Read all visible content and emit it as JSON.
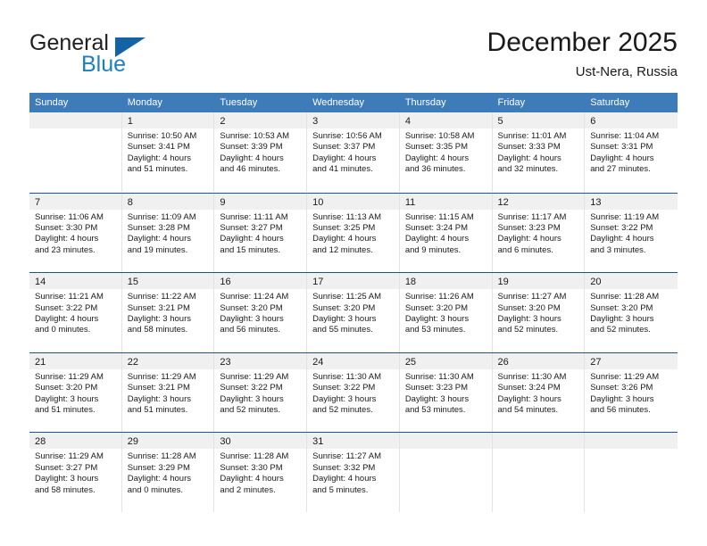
{
  "brand": {
    "name_top": "General",
    "name_bottom": "Blue",
    "triangle_color": "#1464a5",
    "blue_color": "#1b7fc4"
  },
  "header": {
    "title": "December 2025",
    "subtitle": "Ust-Nera, Russia"
  },
  "theme": {
    "header_row_bg": "#3d7cb8",
    "header_row_text": "#ffffff",
    "week_divider": "#1a5694",
    "daynum_band_bg": "#f0f0f0",
    "cell_divider": "#e3e3e3",
    "text": "#1a1a1a"
  },
  "weekdays": [
    "Sunday",
    "Monday",
    "Tuesday",
    "Wednesday",
    "Thursday",
    "Friday",
    "Saturday"
  ],
  "weeks": [
    [
      {
        "day": "",
        "sunrise": "",
        "sunset": "",
        "daylight1": "",
        "daylight2": ""
      },
      {
        "day": "1",
        "sunrise": "Sunrise: 10:50 AM",
        "sunset": "Sunset: 3:41 PM",
        "daylight1": "Daylight: 4 hours",
        "daylight2": "and 51 minutes."
      },
      {
        "day": "2",
        "sunrise": "Sunrise: 10:53 AM",
        "sunset": "Sunset: 3:39 PM",
        "daylight1": "Daylight: 4 hours",
        "daylight2": "and 46 minutes."
      },
      {
        "day": "3",
        "sunrise": "Sunrise: 10:56 AM",
        "sunset": "Sunset: 3:37 PM",
        "daylight1": "Daylight: 4 hours",
        "daylight2": "and 41 minutes."
      },
      {
        "day": "4",
        "sunrise": "Sunrise: 10:58 AM",
        "sunset": "Sunset: 3:35 PM",
        "daylight1": "Daylight: 4 hours",
        "daylight2": "and 36 minutes."
      },
      {
        "day": "5",
        "sunrise": "Sunrise: 11:01 AM",
        "sunset": "Sunset: 3:33 PM",
        "daylight1": "Daylight: 4 hours",
        "daylight2": "and 32 minutes."
      },
      {
        "day": "6",
        "sunrise": "Sunrise: 11:04 AM",
        "sunset": "Sunset: 3:31 PM",
        "daylight1": "Daylight: 4 hours",
        "daylight2": "and 27 minutes."
      }
    ],
    [
      {
        "day": "7",
        "sunrise": "Sunrise: 11:06 AM",
        "sunset": "Sunset: 3:30 PM",
        "daylight1": "Daylight: 4 hours",
        "daylight2": "and 23 minutes."
      },
      {
        "day": "8",
        "sunrise": "Sunrise: 11:09 AM",
        "sunset": "Sunset: 3:28 PM",
        "daylight1": "Daylight: 4 hours",
        "daylight2": "and 19 minutes."
      },
      {
        "day": "9",
        "sunrise": "Sunrise: 11:11 AM",
        "sunset": "Sunset: 3:27 PM",
        "daylight1": "Daylight: 4 hours",
        "daylight2": "and 15 minutes."
      },
      {
        "day": "10",
        "sunrise": "Sunrise: 11:13 AM",
        "sunset": "Sunset: 3:25 PM",
        "daylight1": "Daylight: 4 hours",
        "daylight2": "and 12 minutes."
      },
      {
        "day": "11",
        "sunrise": "Sunrise: 11:15 AM",
        "sunset": "Sunset: 3:24 PM",
        "daylight1": "Daylight: 4 hours",
        "daylight2": "and 9 minutes."
      },
      {
        "day": "12",
        "sunrise": "Sunrise: 11:17 AM",
        "sunset": "Sunset: 3:23 PM",
        "daylight1": "Daylight: 4 hours",
        "daylight2": "and 6 minutes."
      },
      {
        "day": "13",
        "sunrise": "Sunrise: 11:19 AM",
        "sunset": "Sunset: 3:22 PM",
        "daylight1": "Daylight: 4 hours",
        "daylight2": "and 3 minutes."
      }
    ],
    [
      {
        "day": "14",
        "sunrise": "Sunrise: 11:21 AM",
        "sunset": "Sunset: 3:22 PM",
        "daylight1": "Daylight: 4 hours",
        "daylight2": "and 0 minutes."
      },
      {
        "day": "15",
        "sunrise": "Sunrise: 11:22 AM",
        "sunset": "Sunset: 3:21 PM",
        "daylight1": "Daylight: 3 hours",
        "daylight2": "and 58 minutes."
      },
      {
        "day": "16",
        "sunrise": "Sunrise: 11:24 AM",
        "sunset": "Sunset: 3:20 PM",
        "daylight1": "Daylight: 3 hours",
        "daylight2": "and 56 minutes."
      },
      {
        "day": "17",
        "sunrise": "Sunrise: 11:25 AM",
        "sunset": "Sunset: 3:20 PM",
        "daylight1": "Daylight: 3 hours",
        "daylight2": "and 55 minutes."
      },
      {
        "day": "18",
        "sunrise": "Sunrise: 11:26 AM",
        "sunset": "Sunset: 3:20 PM",
        "daylight1": "Daylight: 3 hours",
        "daylight2": "and 53 minutes."
      },
      {
        "day": "19",
        "sunrise": "Sunrise: 11:27 AM",
        "sunset": "Sunset: 3:20 PM",
        "daylight1": "Daylight: 3 hours",
        "daylight2": "and 52 minutes."
      },
      {
        "day": "20",
        "sunrise": "Sunrise: 11:28 AM",
        "sunset": "Sunset: 3:20 PM",
        "daylight1": "Daylight: 3 hours",
        "daylight2": "and 52 minutes."
      }
    ],
    [
      {
        "day": "21",
        "sunrise": "Sunrise: 11:29 AM",
        "sunset": "Sunset: 3:20 PM",
        "daylight1": "Daylight: 3 hours",
        "daylight2": "and 51 minutes."
      },
      {
        "day": "22",
        "sunrise": "Sunrise: 11:29 AM",
        "sunset": "Sunset: 3:21 PM",
        "daylight1": "Daylight: 3 hours",
        "daylight2": "and 51 minutes."
      },
      {
        "day": "23",
        "sunrise": "Sunrise: 11:29 AM",
        "sunset": "Sunset: 3:22 PM",
        "daylight1": "Daylight: 3 hours",
        "daylight2": "and 52 minutes."
      },
      {
        "day": "24",
        "sunrise": "Sunrise: 11:30 AM",
        "sunset": "Sunset: 3:22 PM",
        "daylight1": "Daylight: 3 hours",
        "daylight2": "and 52 minutes."
      },
      {
        "day": "25",
        "sunrise": "Sunrise: 11:30 AM",
        "sunset": "Sunset: 3:23 PM",
        "daylight1": "Daylight: 3 hours",
        "daylight2": "and 53 minutes."
      },
      {
        "day": "26",
        "sunrise": "Sunrise: 11:30 AM",
        "sunset": "Sunset: 3:24 PM",
        "daylight1": "Daylight: 3 hours",
        "daylight2": "and 54 minutes."
      },
      {
        "day": "27",
        "sunrise": "Sunrise: 11:29 AM",
        "sunset": "Sunset: 3:26 PM",
        "daylight1": "Daylight: 3 hours",
        "daylight2": "and 56 minutes."
      }
    ],
    [
      {
        "day": "28",
        "sunrise": "Sunrise: 11:29 AM",
        "sunset": "Sunset: 3:27 PM",
        "daylight1": "Daylight: 3 hours",
        "daylight2": "and 58 minutes."
      },
      {
        "day": "29",
        "sunrise": "Sunrise: 11:28 AM",
        "sunset": "Sunset: 3:29 PM",
        "daylight1": "Daylight: 4 hours",
        "daylight2": "and 0 minutes."
      },
      {
        "day": "30",
        "sunrise": "Sunrise: 11:28 AM",
        "sunset": "Sunset: 3:30 PM",
        "daylight1": "Daylight: 4 hours",
        "daylight2": "and 2 minutes."
      },
      {
        "day": "31",
        "sunrise": "Sunrise: 11:27 AM",
        "sunset": "Sunset: 3:32 PM",
        "daylight1": "Daylight: 4 hours",
        "daylight2": "and 5 minutes."
      },
      {
        "day": "",
        "sunrise": "",
        "sunset": "",
        "daylight1": "",
        "daylight2": ""
      },
      {
        "day": "",
        "sunrise": "",
        "sunset": "",
        "daylight1": "",
        "daylight2": ""
      },
      {
        "day": "",
        "sunrise": "",
        "sunset": "",
        "daylight1": "",
        "daylight2": ""
      }
    ]
  ]
}
